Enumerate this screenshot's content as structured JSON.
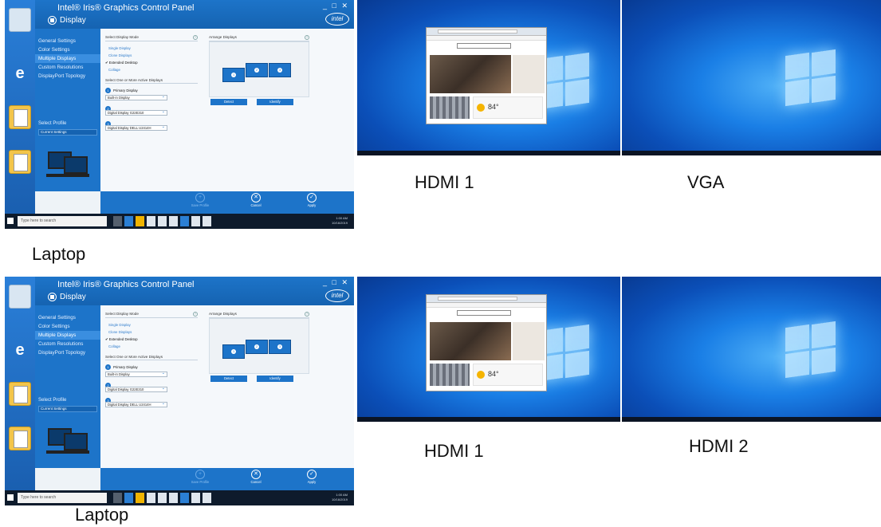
{
  "panels": [
    {
      "laptop": {
        "window_title": "Intel® Iris® Graphics Control Panel",
        "section": "Display",
        "window_controls": "_ □ ✕",
        "brand": "intel",
        "sidebar": [
          "General Settings",
          "Color Settings",
          "Multiple Displays",
          "Custom Resolutions",
          "DisplayPort Topology"
        ],
        "active_sidebar": 2,
        "profile_label": "Select Profile",
        "profile_value": "Current Settings",
        "mode_title": "Select Display Mode",
        "modes": [
          "Single Display",
          "Clone Displays",
          "Extended Desktop",
          "Collage"
        ],
        "checked_mode": 2,
        "active_title": "Select One or More Active Displays",
        "primary_label": "Primary Display",
        "displays": [
          "Built-in Display",
          "Digital Display G22E310",
          "Digital Display DELL U2414H"
        ],
        "arrange_title": "Arrange Displays",
        "tiles": [
          "1",
          "2",
          "3"
        ],
        "detect_label": "Detect",
        "identify_label": "Identify",
        "save_label": "Save Profile",
        "cancel_label": "Cancel",
        "apply_label": "Apply",
        "search_placeholder": "Type here to search",
        "tray_time": "1:00 AM",
        "tray_date": "10/16/2019"
      },
      "laptop_caption": "Laptop",
      "monitor1_caption": "HDMI 1",
      "monitor2_caption": "VGA",
      "weather_temp": "84°"
    },
    {
      "laptop": {
        "window_title": "Intel® Iris® Graphics Control Panel",
        "section": "Display",
        "window_controls": "_ □ ✕",
        "brand": "intel",
        "sidebar": [
          "General Settings",
          "Color Settings",
          "Multiple Displays",
          "Custom Resolutions",
          "DisplayPort Topology"
        ],
        "active_sidebar": 2,
        "profile_label": "Select Profile",
        "profile_value": "Current Settings",
        "mode_title": "Select Display Mode",
        "modes": [
          "Single Display",
          "Clone Displays",
          "Extended Desktop",
          "Collage"
        ],
        "checked_mode": 2,
        "active_title": "Select One or More Active Displays",
        "primary_label": "Primary Display",
        "displays": [
          "Built-in Display",
          "Digital Display G22E310",
          "Digital Display DELL U2414H"
        ],
        "arrange_title": "Arrange Displays",
        "tiles": [
          "1",
          "2",
          "3"
        ],
        "detect_label": "Detect",
        "identify_label": "Identify",
        "save_label": "Save Profile",
        "cancel_label": "Cancel",
        "apply_label": "Apply",
        "search_placeholder": "Type here to search",
        "tray_time": "1:00 AM",
        "tray_date": "10/16/2019"
      },
      "laptop_caption": "Laptop",
      "monitor1_caption": "HDMI 1",
      "monitor2_caption": "HDMI 2",
      "weather_temp": "84°"
    }
  ],
  "colors": {
    "intel_blue": "#1d74c9",
    "taskbar": "#0e1b2c",
    "desktop_blue": "#1a7fe6"
  }
}
